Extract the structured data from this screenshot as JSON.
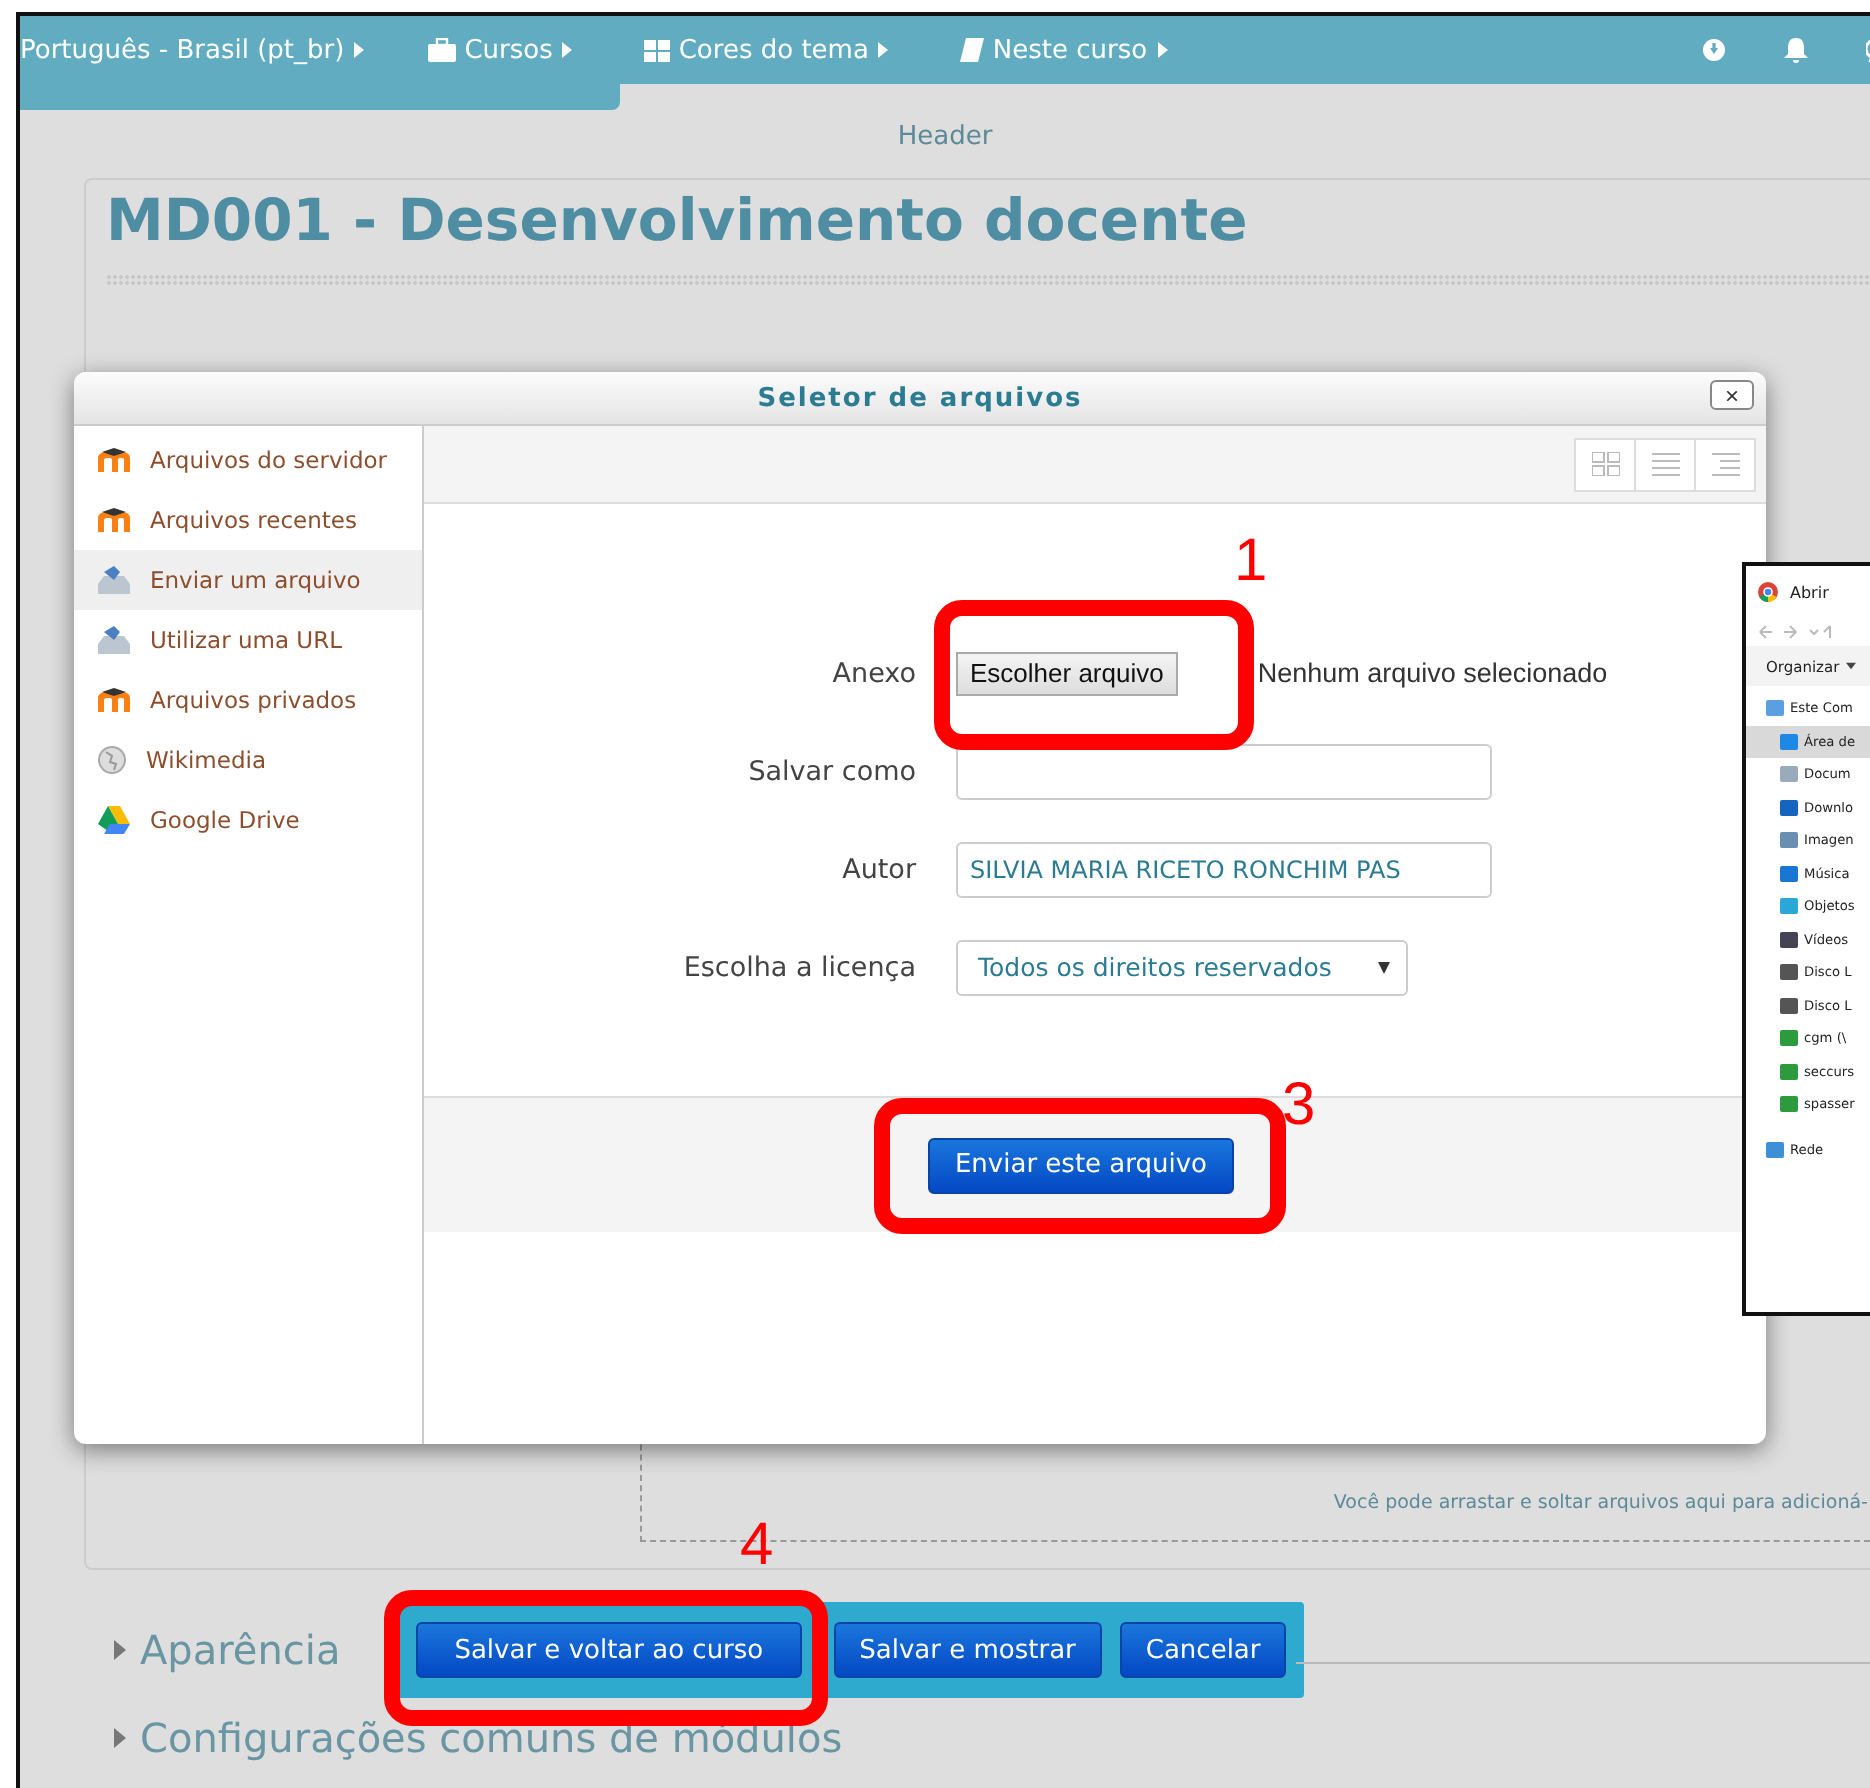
{
  "navbar": {
    "items": [
      {
        "label": "Português - Brasil (pt_br)",
        "kind": "plain"
      },
      {
        "label": "Cursos",
        "kind": "courses"
      },
      {
        "label": "Cores do tema",
        "kind": "theme"
      },
      {
        "label": "Neste curso",
        "kind": "course"
      }
    ]
  },
  "page_header": "Header",
  "course_title": "MD001 - Desenvolvimento docente",
  "file_picker": {
    "title": "Seletor de arquivos",
    "close": "×",
    "repositories": [
      {
        "label": "Arquivos do servidor",
        "kind": "moodle",
        "selected": false
      },
      {
        "label": "Arquivos recentes",
        "kind": "moodle",
        "selected": false
      },
      {
        "label": "Enviar um arquivo",
        "kind": "upload",
        "selected": true
      },
      {
        "label": "Utilizar uma URL",
        "kind": "upload",
        "selected": false
      },
      {
        "label": "Arquivos privados",
        "kind": "moodle",
        "selected": false
      },
      {
        "label": "Wikimedia",
        "kind": "wiki",
        "selected": false
      },
      {
        "label": "Google Drive",
        "kind": "drive",
        "selected": false
      }
    ],
    "fields": [
      {
        "kind": "file",
        "label": "Anexo",
        "button": "Escolher arquivo",
        "status": "Nenhum arquivo selecionado"
      },
      {
        "kind": "text",
        "label": "Salvar como"
      },
      {
        "kind": "text",
        "label": "Autor",
        "value": "SILVIA MARIA RICETO RONCHIM PAS"
      },
      {
        "kind": "select",
        "label": "Escolha a licença",
        "value": "Todos os direitos reservados"
      }
    ],
    "submit": "Enviar este arquivo"
  },
  "open_dialog": {
    "title": "Abrir",
    "toolbar": "Organizar",
    "items": [
      {
        "label": "Este Com",
        "kind": "computer",
        "selected": false,
        "children": [
          {
            "label": "Área de",
            "kind": "desktop",
            "selected": true
          },
          {
            "label": "Docum",
            "kind": "document",
            "selected": false
          },
          {
            "label": "Downlo",
            "kind": "download",
            "selected": false
          },
          {
            "label": "Imagen",
            "kind": "image",
            "selected": false
          },
          {
            "label": "Música",
            "kind": "music",
            "selected": false
          },
          {
            "label": "Objetos",
            "kind": "object",
            "selected": false
          },
          {
            "label": "Vídeos",
            "kind": "video",
            "selected": false
          },
          {
            "label": "Disco L",
            "kind": "disk",
            "selected": false
          },
          {
            "label": "Disco L",
            "kind": "disk",
            "selected": false
          },
          {
            "label": "cgm (\\",
            "kind": "network",
            "selected": false
          },
          {
            "label": "seccurs",
            "kind": "network",
            "selected": false
          },
          {
            "label": "spasser",
            "kind": "network",
            "selected": false
          }
        ]
      },
      {
        "label": "Rede",
        "kind": "network-cloud",
        "selected": false
      }
    ]
  },
  "dropzone": {
    "text": "Você pode arrastar e soltar arquivos aqui para adicioná-"
  },
  "sections": [
    {
      "label": "Aparência"
    },
    {
      "label": "Configurações comuns de módulos"
    }
  ],
  "form_buttons": [
    "Salvar e voltar ao curso",
    "Salvar e mostrar",
    "Cancelar"
  ],
  "annotations": [
    {
      "number": "1"
    },
    {
      "number": "3"
    },
    {
      "number": "4"
    }
  ]
}
